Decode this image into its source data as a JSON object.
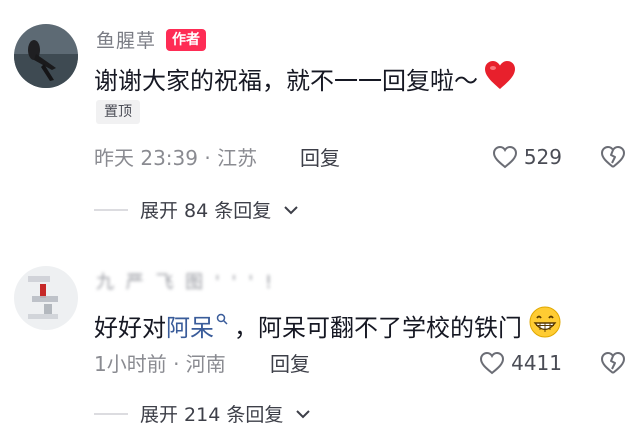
{
  "comments": [
    {
      "username": "鱼腥草",
      "author_badge": "作者",
      "text": "谢谢大家的祝福，就不一一回复啦～",
      "pinned_label": "置顶",
      "meta": "昨天 23:39 · 江苏",
      "reply_label": "回复",
      "likes": "529",
      "expand_label": "展开 84 条回复",
      "avatar_icon": "profile-photo-icon",
      "emoji": "red-heart-icon"
    },
    {
      "username": "九 严 飞 图 ' ' ' !",
      "text_before": "好好对",
      "mention": "阿呆",
      "text_after": "，阿呆可翻不了学校的铁门",
      "meta": "1小时前 · 河南",
      "reply_label": "回复",
      "likes": "4411",
      "expand_label": "展开 214 条回复",
      "avatar_icon": "profile-photo-icon",
      "emoji": "grinning-face-icon"
    }
  ],
  "colors": {
    "accent": "#fe2c55",
    "mention": "#3a5c9a",
    "heart": "#e8202c"
  }
}
